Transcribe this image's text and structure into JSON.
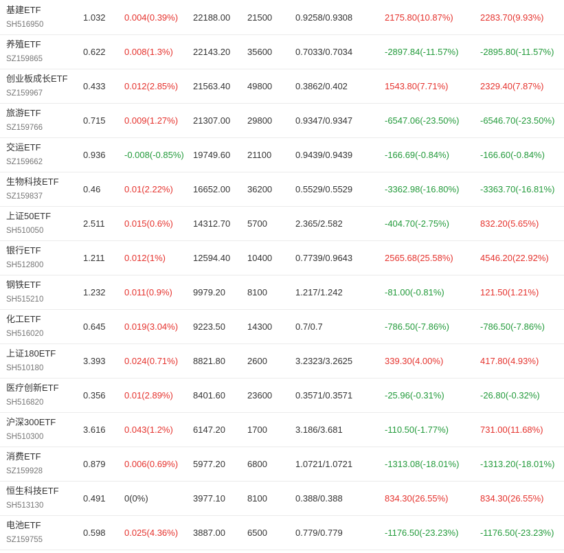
{
  "colors": {
    "up": "#e5322d",
    "down": "#229a3a",
    "flat": "#333333"
  },
  "rows": [
    {
      "name": "基建ETF",
      "code": "SH516950",
      "price": "1.032",
      "change": "0.004(0.39%)",
      "change_dir": "up",
      "amount": "22188.00",
      "volume": "21500",
      "range": "0.9258/0.9308",
      "profit1": "2175.80(10.87%)",
      "profit1_dir": "up",
      "profit2": "2283.70(9.93%)",
      "profit2_dir": "up"
    },
    {
      "name": "养殖ETF",
      "code": "SZ159865",
      "price": "0.622",
      "change": "0.008(1.3%)",
      "change_dir": "up",
      "amount": "22143.20",
      "volume": "35600",
      "range": "0.7033/0.7034",
      "profit1": "-2897.84(-11.57%)",
      "profit1_dir": "down",
      "profit2": "-2895.80(-11.57%)",
      "profit2_dir": "down"
    },
    {
      "name": "创业板成长ETF",
      "code": "SZ159967",
      "price": "0.433",
      "change": "0.012(2.85%)",
      "change_dir": "up",
      "amount": "21563.40",
      "volume": "49800",
      "range": "0.3862/0.402",
      "profit1": "1543.80(7.71%)",
      "profit1_dir": "up",
      "profit2": "2329.40(7.87%)",
      "profit2_dir": "up"
    },
    {
      "name": "旅游ETF",
      "code": "SZ159766",
      "price": "0.715",
      "change": "0.009(1.27%)",
      "change_dir": "up",
      "amount": "21307.00",
      "volume": "29800",
      "range": "0.9347/0.9347",
      "profit1": "-6547.06(-23.50%)",
      "profit1_dir": "down",
      "profit2": "-6546.70(-23.50%)",
      "profit2_dir": "down"
    },
    {
      "name": "交运ETF",
      "code": "SZ159662",
      "price": "0.936",
      "change": "-0.008(-0.85%)",
      "change_dir": "down",
      "amount": "19749.60",
      "volume": "21100",
      "range": "0.9439/0.9439",
      "profit1": "-166.69(-0.84%)",
      "profit1_dir": "down",
      "profit2": "-166.60(-0.84%)",
      "profit2_dir": "down"
    },
    {
      "name": "生物科技ETF",
      "code": "SZ159837",
      "price": "0.46",
      "change": "0.01(2.22%)",
      "change_dir": "up",
      "amount": "16652.00",
      "volume": "36200",
      "range": "0.5529/0.5529",
      "profit1": "-3362.98(-16.80%)",
      "profit1_dir": "down",
      "profit2": "-3363.70(-16.81%)",
      "profit2_dir": "down"
    },
    {
      "name": "上证50ETF",
      "code": "SH510050",
      "price": "2.511",
      "change": "0.015(0.6%)",
      "change_dir": "up",
      "amount": "14312.70",
      "volume": "5700",
      "range": "2.365/2.582",
      "profit1": "-404.70(-2.75%)",
      "profit1_dir": "down",
      "profit2": "832.20(5.65%)",
      "profit2_dir": "up"
    },
    {
      "name": "银行ETF",
      "code": "SH512800",
      "price": "1.211",
      "change": "0.012(1%)",
      "change_dir": "up",
      "amount": "12594.40",
      "volume": "10400",
      "range": "0.7739/0.9643",
      "profit1": "2565.68(25.58%)",
      "profit1_dir": "up",
      "profit2": "4546.20(22.92%)",
      "profit2_dir": "up"
    },
    {
      "name": "钢铁ETF",
      "code": "SH515210",
      "price": "1.232",
      "change": "0.011(0.9%)",
      "change_dir": "up",
      "amount": "9979.20",
      "volume": "8100",
      "range": "1.217/1.242",
      "profit1": "-81.00(-0.81%)",
      "profit1_dir": "down",
      "profit2": "121.50(1.21%)",
      "profit2_dir": "up"
    },
    {
      "name": "化工ETF",
      "code": "SH516020",
      "price": "0.645",
      "change": "0.019(3.04%)",
      "change_dir": "up",
      "amount": "9223.50",
      "volume": "14300",
      "range": "0.7/0.7",
      "profit1": "-786.50(-7.86%)",
      "profit1_dir": "down",
      "profit2": "-786.50(-7.86%)",
      "profit2_dir": "down"
    },
    {
      "name": "上证180ETF",
      "code": "SH510180",
      "price": "3.393",
      "change": "0.024(0.71%)",
      "change_dir": "up",
      "amount": "8821.80",
      "volume": "2600",
      "range": "3.2323/3.2625",
      "profit1": "339.30(4.00%)",
      "profit1_dir": "up",
      "profit2": "417.80(4.93%)",
      "profit2_dir": "up"
    },
    {
      "name": "医疗创新ETF",
      "code": "SH516820",
      "price": "0.356",
      "change": "0.01(2.89%)",
      "change_dir": "up",
      "amount": "8401.60",
      "volume": "23600",
      "range": "0.3571/0.3571",
      "profit1": "-25.96(-0.31%)",
      "profit1_dir": "down",
      "profit2": "-26.80(-0.32%)",
      "profit2_dir": "down"
    },
    {
      "name": "沪深300ETF",
      "code": "SH510300",
      "price": "3.616",
      "change": "0.043(1.2%)",
      "change_dir": "up",
      "amount": "6147.20",
      "volume": "1700",
      "range": "3.186/3.681",
      "profit1": "-110.50(-1.77%)",
      "profit1_dir": "down",
      "profit2": "731.00(11.68%)",
      "profit2_dir": "up"
    },
    {
      "name": "消费ETF",
      "code": "SZ159928",
      "price": "0.879",
      "change": "0.006(0.69%)",
      "change_dir": "up",
      "amount": "5977.20",
      "volume": "6800",
      "range": "1.0721/1.0721",
      "profit1": "-1313.08(-18.01%)",
      "profit1_dir": "down",
      "profit2": "-1313.20(-18.01%)",
      "profit2_dir": "down"
    },
    {
      "name": "恒生科技ETF",
      "code": "SH513130",
      "price": "0.491",
      "change": "0(0%)",
      "change_dir": "flat",
      "amount": "3977.10",
      "volume": "8100",
      "range": "0.388/0.388",
      "profit1": "834.30(26.55%)",
      "profit1_dir": "up",
      "profit2": "834.30(26.55%)",
      "profit2_dir": "up"
    },
    {
      "name": "电池ETF",
      "code": "SZ159755",
      "price": "0.598",
      "change": "0.025(4.36%)",
      "change_dir": "up",
      "amount": "3887.00",
      "volume": "6500",
      "range": "0.779/0.779",
      "profit1": "-1176.50(-23.23%)",
      "profit1_dir": "down",
      "profit2": "-1176.50(-23.23%)",
      "profit2_dir": "down"
    }
  ]
}
